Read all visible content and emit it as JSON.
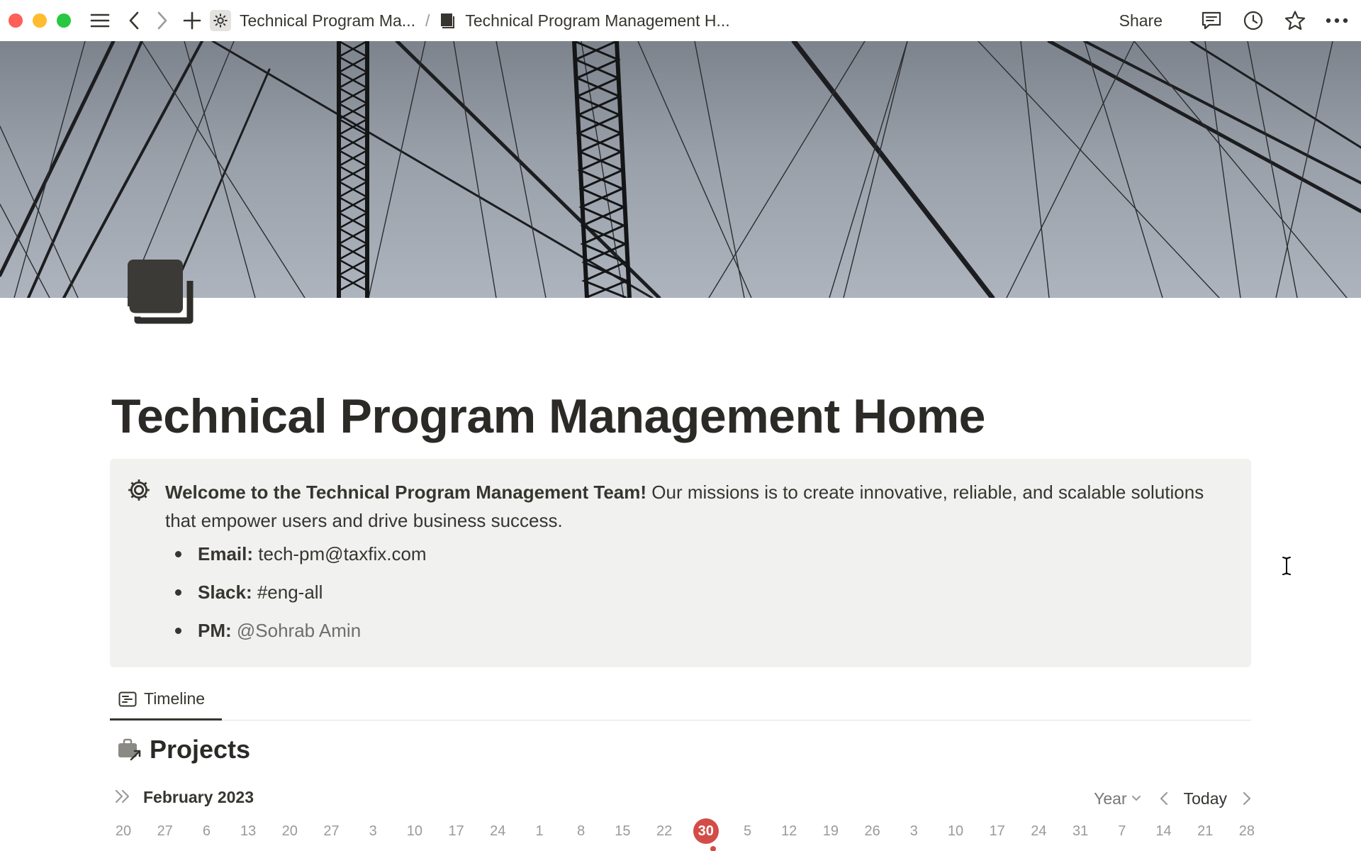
{
  "window": {
    "title": "Technical Program Management Home"
  },
  "topbar": {
    "breadcrumbs": [
      {
        "label": "Technical Program Ma...",
        "icon": "gear-icon"
      },
      {
        "label": "Technical Program Management H...",
        "icon": "book-icon"
      }
    ],
    "separator": "/",
    "share_label": "Share",
    "right_icons": [
      "comment-icon",
      "history-clock-icon",
      "star-icon",
      "more-icon"
    ]
  },
  "page": {
    "icon": "book-icon",
    "title": "Technical Program Management Home"
  },
  "callout": {
    "icon": "gear-icon",
    "heading": "Welcome to the Technical Program Management Team!",
    "body": " Our missions is to create innovative, reliable, and scalable solutions that empower users and drive business success.",
    "items": [
      {
        "label": "Email:",
        "value": " tech-pm@taxfix.com"
      },
      {
        "label": "Slack:",
        "value": " #eng-all"
      },
      {
        "label": "PM:",
        "value": " @Sohrab Amin"
      }
    ]
  },
  "tabs": [
    {
      "label": "Timeline",
      "icon": "timeline-icon",
      "active": true
    }
  ],
  "projects": {
    "title": "Projects",
    "icon": "briefcase-icon"
  },
  "timeline": {
    "month_label": "February 2023",
    "scale_label": "Year",
    "today_label": "Today",
    "dates": [
      "20",
      "27",
      "6",
      "13",
      "20",
      "27",
      "3",
      "10",
      "17",
      "24",
      "1",
      "8",
      "15",
      "22",
      "30",
      "5",
      "12",
      "19",
      "26",
      "3",
      "10",
      "17",
      "24",
      "31",
      "7",
      "14",
      "21",
      "28"
    ],
    "today_date": "30",
    "today_color": "#d44c47"
  },
  "colors": {
    "text": "#37352f",
    "callout_bg": "#f1f1ef",
    "muted": "#9b9a97"
  }
}
